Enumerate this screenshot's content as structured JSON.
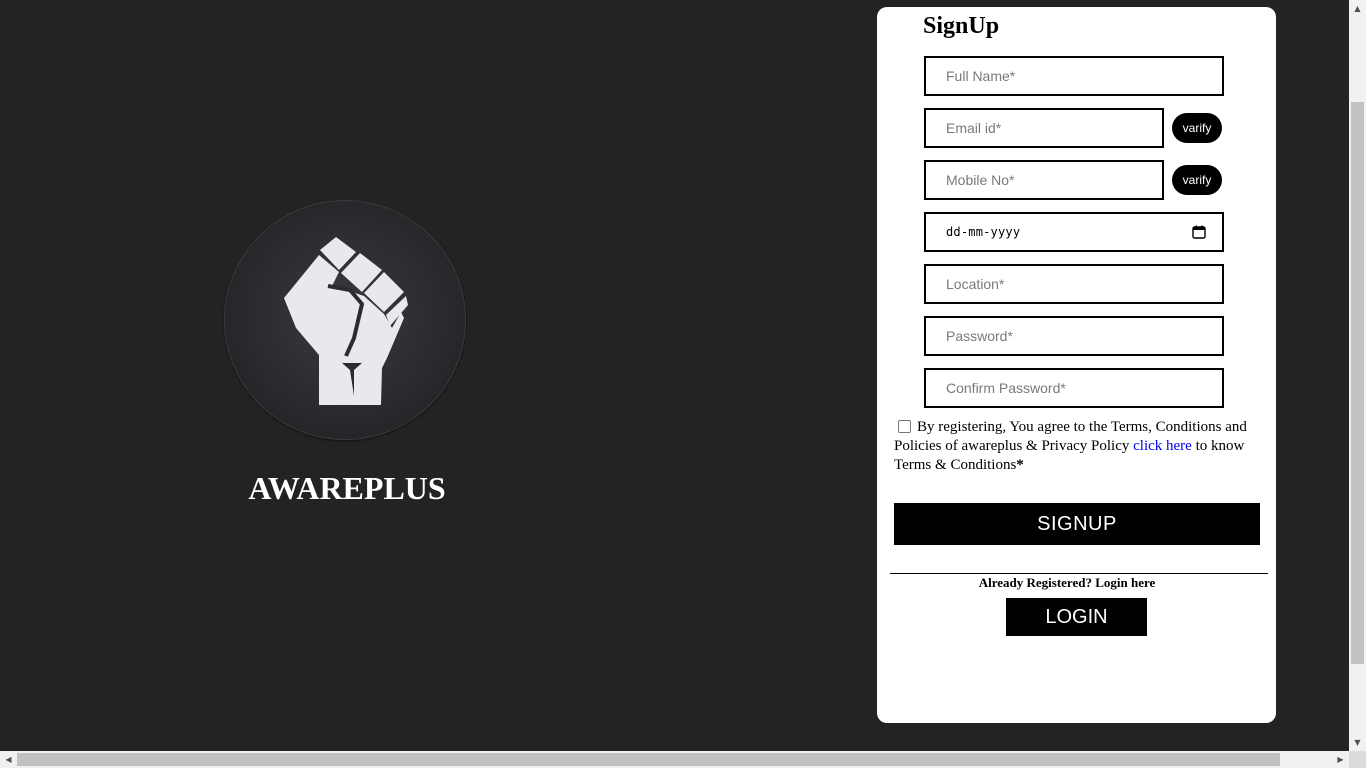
{
  "brand": {
    "name": "AWAREPLUS",
    "logo_icon": "raised-fist-icon"
  },
  "signup": {
    "title": "SignUp",
    "fields": {
      "full_name": {
        "placeholder": "Full Name*",
        "value": ""
      },
      "email": {
        "placeholder": "Email id*",
        "value": ""
      },
      "mobile": {
        "placeholder": "Mobile No*",
        "value": ""
      },
      "dob": {
        "display": "dd-mm-yyyy",
        "icon": "calendar-icon"
      },
      "location": {
        "placeholder": "Location*",
        "value": ""
      },
      "password": {
        "placeholder": "Password*",
        "value": ""
      },
      "confirm_password": {
        "placeholder": "Confirm Password*",
        "value": ""
      }
    },
    "verify_email_label": "varify",
    "verify_mobile_label": "varify",
    "terms": {
      "checked": false,
      "text_before": "By registering, You agree to the Terms, Conditions and Policies of awareplus & Privacy Policy ",
      "link_text": "click here",
      "text_after": " to know Terms & Conditions",
      "required_mark": "*"
    },
    "signup_button": "SIGNUP",
    "already_registered": "Already Registered? Login here",
    "login_button": "LOGIN"
  },
  "colors": {
    "background": "#232323",
    "card": "#ffffff",
    "button": "#000000",
    "link": "#0000ee",
    "logo_fist": "#e8e9ed"
  }
}
